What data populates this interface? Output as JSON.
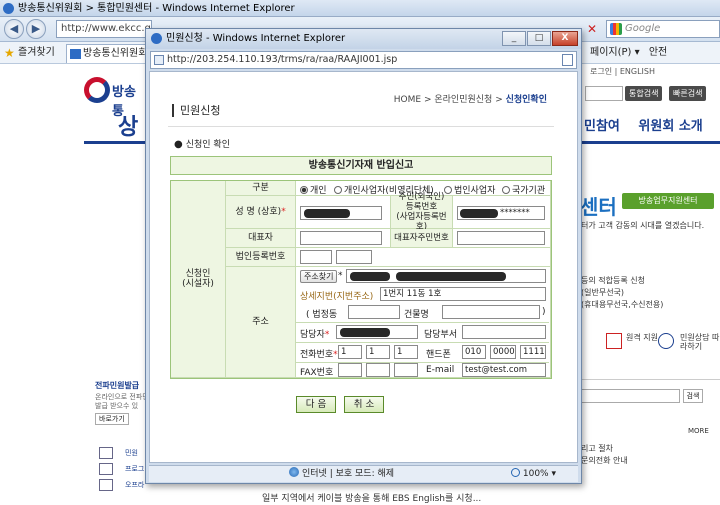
{
  "bg_browser": {
    "title": "방송통신위원회 > 통합민원센터 - Windows Internet Explorer",
    "address": "http://www.ekcc.go",
    "search_placeholder": "Google",
    "favorites_label": "즐겨찾기",
    "tab_label": "방송통신위원회",
    "tools": [
      "페이지(P) ▾",
      "안전"
    ]
  },
  "bg_page": {
    "logo_name": "방송통",
    "sign_links": "로그인  |  ENGLISH",
    "integrated_search": "통합검색",
    "quick_search": "빠른검색",
    "menu_left": "상",
    "menu_right": [
      "민참여",
      "위원회 소개"
    ],
    "center_title": "센터",
    "support_button": "방송업무지원센터",
    "center_desc": "터가 고객 감동의 시대를 열겠습니다.",
    "lines": [
      "등의 적합등록 신청",
      "(일반무선국)",
      "(휴대용무선국,수신전용)"
    ],
    "service_icons": [
      {
        "icon": "remote-service-icon",
        "label": "원격\n지원"
      },
      {
        "icon": "headset-icon",
        "label": "민원상담\n따라하기"
      }
    ],
    "search_btn": "검색",
    "more": "MORE",
    "right_bottom": [
      "리고 절차",
      "문의전화 안내"
    ],
    "left_title": "전파민원발급",
    "left_desc": "온라인으로 전파민\n발급 받으수 있",
    "left_button": "바로가기",
    "left_items": [
      "민원",
      "프로그",
      "오프라"
    ],
    "news": "일부 지역에서 케이블 방송을 통해 EBS English를 시청..."
  },
  "popup": {
    "title": "민원신청 - Windows Internet Explorer",
    "address": "http://203.254.110.193/trms/ra/raa/RAAJI001.jsp",
    "window_buttons": [
      "_",
      "□",
      "X"
    ],
    "content_title": "민원신청",
    "breadcrumb": {
      "home": "HOME",
      "sep": " > ",
      "parent": "온라인민원신청",
      "current": "신청인확인"
    },
    "section": "신청인 확인",
    "form_title": "방송통신기자재 반입신고",
    "applicant_label": "신청인\n(시설자)",
    "labels": {
      "category": "구분",
      "name": "성 명 (상호)",
      "representative": "대표자",
      "corp_reg": "법인등록번호",
      "address": "주소",
      "resident_id": "주민(외국인)\n등록번호\n(사업자등록번호)",
      "rep_resident_id": "대표자주민번호"
    },
    "radio_options": [
      "개인",
      "개인사업자(비영리단체)",
      "법인사업자",
      "국가기관"
    ],
    "radio_selected": 0,
    "resident_id_tail": "*******",
    "address_search_btn": "주소찾기",
    "address_detail_label": "상세지번(지번주소)",
    "address_detail_value": "1번지 11동 1호",
    "dong_label": "( 법정동",
    "building_label": "건물명",
    "close_paren": ")",
    "manager_label": "담당자",
    "dept_label": "담당부서",
    "phone_label": "전화번호",
    "phone_values": [
      "1",
      "1",
      "1"
    ],
    "mobile_label": "핸드폰",
    "mobile_values": [
      "010",
      "0000",
      "1111"
    ],
    "fax_label": "FAX번호",
    "email_label": "E-mail",
    "email_value": "test@test.com",
    "next_btn": "다 음",
    "cancel_btn": "취 소",
    "status_zone": "인터넷 | 보호 모드: 해제",
    "status_zoom": "100%"
  }
}
